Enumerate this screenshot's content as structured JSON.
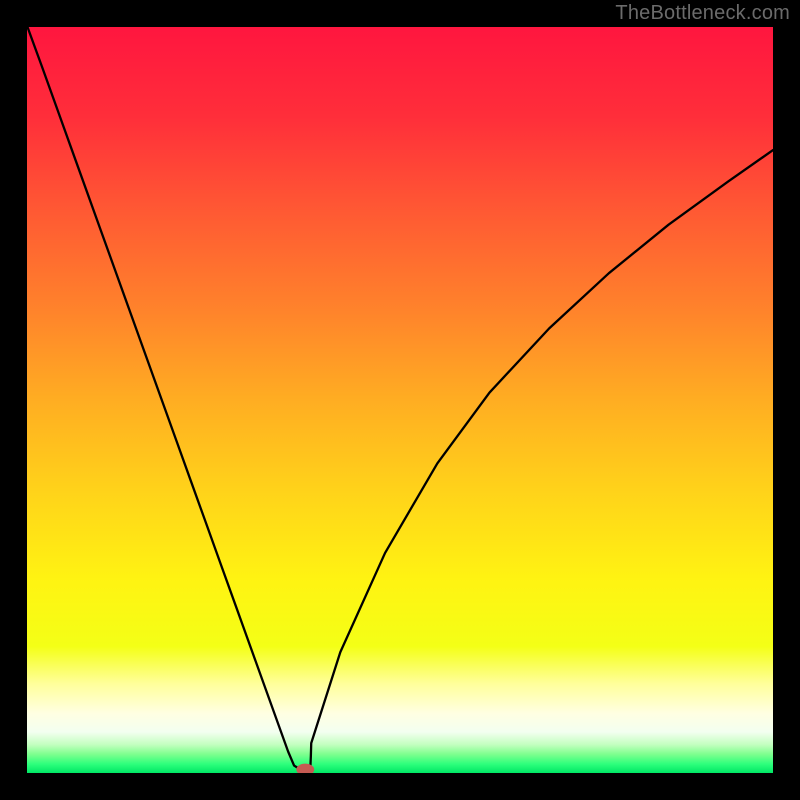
{
  "watermark": "TheBottleneck.com",
  "chart_data": {
    "type": "line",
    "title": "",
    "xlabel": "",
    "ylabel": "",
    "xlim": [
      0,
      100
    ],
    "ylim": [
      0,
      100
    ],
    "background_gradient_stops": [
      {
        "offset": 0.0,
        "color": "#ff163f"
      },
      {
        "offset": 0.12,
        "color": "#ff2e3a"
      },
      {
        "offset": 0.25,
        "color": "#ff5a33"
      },
      {
        "offset": 0.38,
        "color": "#ff832b"
      },
      {
        "offset": 0.5,
        "color": "#ffad22"
      },
      {
        "offset": 0.62,
        "color": "#ffd21a"
      },
      {
        "offset": 0.74,
        "color": "#fff312"
      },
      {
        "offset": 0.83,
        "color": "#f4ff16"
      },
      {
        "offset": 0.88,
        "color": "#ffff9a"
      },
      {
        "offset": 0.92,
        "color": "#ffffe2"
      },
      {
        "offset": 0.945,
        "color": "#f3fff0"
      },
      {
        "offset": 0.962,
        "color": "#c3ffbf"
      },
      {
        "offset": 0.975,
        "color": "#7dff8e"
      },
      {
        "offset": 0.988,
        "color": "#2eff7c"
      },
      {
        "offset": 1.0,
        "color": "#00e765"
      }
    ],
    "series": [
      {
        "name": "curve",
        "x": [
          0.066,
          2,
          4,
          6,
          8,
          10,
          12,
          14,
          16,
          18,
          20,
          22,
          24,
          26,
          28,
          30,
          31,
          32,
          33,
          34,
          35,
          35.8,
          36.5,
          37.2,
          37.9,
          38,
          38.05,
          38.1,
          42,
          48,
          55,
          62,
          70,
          78,
          86,
          94,
          100
        ],
        "y": [
          100,
          94.7,
          89.14,
          83.57,
          78.01,
          72.44,
          66.88,
          61.31,
          55.75,
          50.18,
          44.62,
          39.05,
          33.49,
          27.92,
          22.36,
          16.79,
          14.01,
          11.23,
          8.449,
          5.666,
          2.884,
          1.0,
          0.55,
          0.35,
          0.55,
          1.065,
          2.27,
          4.0,
          16.2,
          29.5,
          41.5,
          51.0,
          59.6,
          67.0,
          73.5,
          79.3,
          83.5
        ]
      }
    ],
    "marker": {
      "x": 37.3,
      "y": 0.45,
      "color": "#c45a52",
      "rx": 1.2,
      "ry": 0.8
    }
  }
}
